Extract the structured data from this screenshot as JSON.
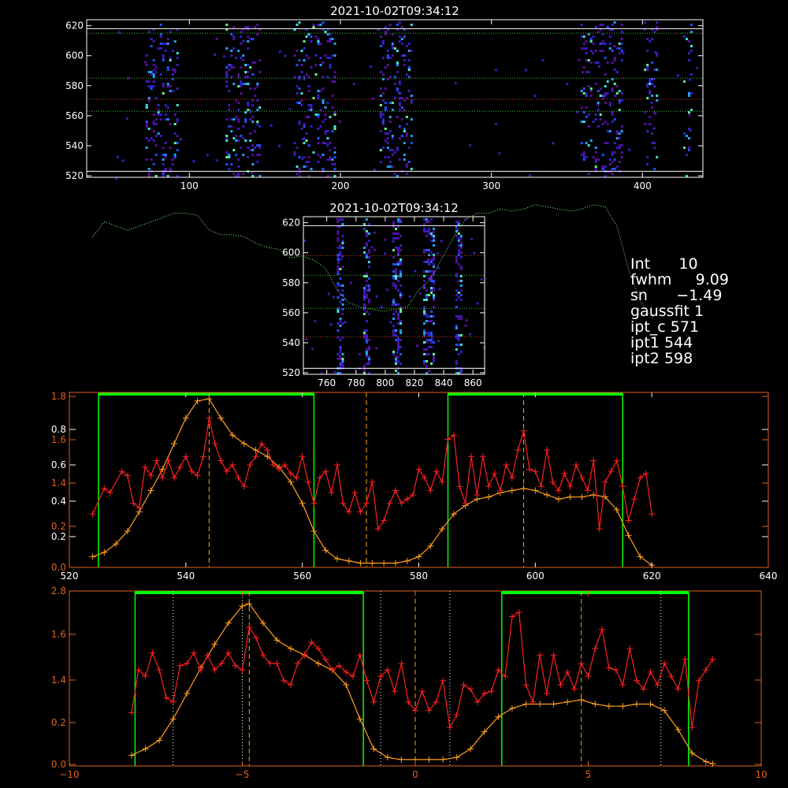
{
  "chart_data": [
    {
      "type": "heatmap",
      "title": "2021-10-02T09:34:12",
      "xlim": [
        32,
        440
      ],
      "ylim": [
        519,
        624
      ],
      "xticks": [
        100,
        200,
        300,
        400
      ],
      "yticks": [
        520,
        540,
        560,
        580,
        600,
        620
      ],
      "vertical_bands": [
        [
          72,
          91
        ],
        [
          125,
          146
        ],
        [
          170,
          196
        ],
        [
          227,
          246
        ],
        [
          360,
          385
        ],
        [
          402,
          408
        ],
        [
          428,
          431
        ]
      ],
      "hlines_white": [
        523,
        618
      ],
      "hlines_green_dotted": [
        563,
        585,
        615
      ],
      "hlines_red_dotted": [
        571
      ]
    },
    {
      "type": "heatmap",
      "title": "2021-10-02T09:34:12",
      "xlim": [
        744,
        868
      ],
      "ylim": [
        519,
        624
      ],
      "xticks": [
        760,
        780,
        800,
        820,
        840,
        860
      ],
      "yticks": [
        520,
        540,
        560,
        580,
        600,
        620
      ],
      "vertical_bands": [
        [
          768,
          770
        ],
        [
          786,
          788
        ],
        [
          806,
          810
        ],
        [
          827,
          832
        ],
        [
          849,
          851
        ]
      ],
      "hlines_white": [
        523,
        618
      ],
      "hlines_green_dotted": [
        563,
        585
      ],
      "hlines_red_dotted": [
        544,
        598
      ]
    },
    {
      "type": "line",
      "xlim": [
        520,
        640
      ],
      "xticks": [
        520,
        540,
        560,
        580,
        600,
        620,
        640
      ],
      "yticks_white": [
        "0.2",
        "0.4",
        "0.6",
        "0.8"
      ],
      "yticks_orange": [
        "0.0",
        "0.2",
        "1.4",
        "1.6",
        "1.8"
      ],
      "windows": [
        [
          525,
          562
        ],
        [
          585,
          615
        ]
      ],
      "vlines_orange_dashed": [
        544,
        571,
        598
      ],
      "series": [
        {
          "x": [
            524,
            526,
            528,
            530,
            532,
            534,
            536,
            538,
            540,
            542,
            544,
            546,
            548,
            550,
            552,
            554,
            556,
            558,
            560,
            562,
            564,
            566,
            568,
            570,
            572,
            574,
            576,
            578,
            580,
            582,
            584,
            586,
            588,
            590,
            592,
            594,
            596,
            598,
            600,
            602,
            604,
            606,
            608,
            610,
            612,
            614,
            616,
            618,
            620
          ],
          "values": [
            0.05,
            0.07,
            0.11,
            0.17,
            0.26,
            0.36,
            0.46,
            0.58,
            0.7,
            0.78,
            0.79,
            0.7,
            0.62,
            0.58,
            0.55,
            0.52,
            0.47,
            0.4,
            0.3,
            0.17,
            0.08,
            0.04,
            0.03,
            0.02,
            0.02,
            0.02,
            0.02,
            0.03,
            0.05,
            0.1,
            0.18,
            0.25,
            0.29,
            0.32,
            0.33,
            0.35,
            0.36,
            0.37,
            0.36,
            0.34,
            0.32,
            0.33,
            0.33,
            0.34,
            0.33,
            0.27,
            0.15,
            0.05,
            0.01
          ]
        },
        {
          "x": [
            524,
            526,
            528,
            530,
            532,
            534,
            536,
            538,
            540,
            542,
            544,
            546,
            548,
            550,
            552,
            554,
            556,
            558,
            560,
            562,
            564,
            566,
            568,
            570,
            572,
            574,
            576,
            578,
            580,
            582,
            584,
            586,
            588,
            590,
            592,
            594,
            596,
            598,
            600,
            602,
            604,
            606,
            608,
            610,
            612,
            614,
            616,
            618,
            620
          ],
          "values": [
            1.55,
            1.62,
            1.6,
            1.58,
            1.6,
            1.62,
            1.64,
            1.66,
            1.66,
            1.65,
            1.58,
            1.56,
            1.56,
            1.55,
            1.52,
            1.5,
            1.49,
            1.45,
            1.46,
            1.44,
            1.4,
            1.3,
            1.24,
            1.22,
            1.21,
            1.2,
            1.21,
            1.22,
            1.3,
            1.35,
            1.45,
            1.55,
            1.63,
            1.66,
            1.66,
            1.68,
            1.67,
            1.68,
            1.7,
            1.69,
            1.68,
            1.67,
            1.68,
            1.7,
            1.69,
            1.6,
            1.4,
            1.25,
            1.17
          ]
        },
        {
          "x": [
            524,
            526,
            527,
            529,
            530,
            531,
            532,
            533,
            534,
            535,
            536,
            537,
            538,
            539,
            540,
            541,
            542,
            543,
            544,
            545,
            546,
            547,
            548,
            549,
            550,
            551,
            552,
            553,
            554,
            555,
            556,
            557,
            558,
            559,
            560,
            561,
            562,
            563,
            564,
            565,
            566,
            567,
            568,
            569,
            570,
            571,
            572,
            573,
            574,
            575,
            576,
            577,
            578,
            579,
            580,
            581,
            582,
            583,
            584,
            585,
            586,
            587,
            588,
            589,
            590,
            591,
            592,
            593,
            594,
            595,
            596,
            597,
            598,
            599,
            600,
            601,
            602,
            603,
            604,
            605,
            606,
            607,
            608,
            609,
            610,
            611,
            612,
            613,
            614,
            615,
            616,
            617,
            618,
            619,
            620
          ],
          "values": [
            0.25,
            0.37,
            0.35,
            0.45,
            0.43,
            0.3,
            0.28,
            0.47,
            0.43,
            0.5,
            0.42,
            0.5,
            0.42,
            0.47,
            0.52,
            0.45,
            0.43,
            0.52,
            0.7,
            0.58,
            0.5,
            0.45,
            0.48,
            0.42,
            0.38,
            0.48,
            0.52,
            0.58,
            0.55,
            0.48,
            0.46,
            0.48,
            0.44,
            0.42,
            0.52,
            0.4,
            0.3,
            0.42,
            0.45,
            0.35,
            0.48,
            0.3,
            0.26,
            0.35,
            0.26,
            0.3,
            0.4,
            0.18,
            0.22,
            0.3,
            0.36,
            0.3,
            0.32,
            0.34,
            0.46,
            0.42,
            0.36,
            0.45,
            0.4,
            0.6,
            0.62,
            0.38,
            0.3,
            0.52,
            0.34,
            0.52,
            0.38,
            0.44,
            0.36,
            0.48,
            0.42,
            0.55,
            0.64,
            0.46,
            0.45,
            0.38,
            0.55,
            0.4,
            0.36,
            0.44,
            0.38,
            0.48,
            0.42,
            0.36,
            0.5,
            0.18,
            0.4,
            0.45,
            0.5,
            0.38,
            0.22,
            0.32,
            0.42,
            0.44,
            0.25
          ]
        }
      ]
    },
    {
      "type": "line",
      "xlim": [
        -10,
        10
      ],
      "xticks": [
        -10,
        -5,
        0,
        5,
        10
      ],
      "yticks": [
        "0.0",
        "0.2",
        "1.4",
        "1.6",
        "2.8"
      ],
      "windows": [
        [
          -8.1,
          -1.5
        ],
        [
          2.5,
          7.9
        ]
      ],
      "vlines_white_dotted": [
        -7.0,
        -5.0,
        -1.0,
        1.0,
        7.1
      ],
      "vlines_orange_dashed": [
        -4.8,
        0.0,
        4.8
      ],
      "series": [
        {
          "x": [
            -8.2,
            -7.8,
            -7.4,
            -7.0,
            -6.6,
            -6.2,
            -5.8,
            -5.4,
            -5.0,
            -4.8,
            -4.4,
            -4.0,
            -3.6,
            -3.2,
            -2.8,
            -2.4,
            -2.0,
            -1.6,
            -1.2,
            -0.8,
            -0.4,
            0.0,
            0.4,
            0.8,
            1.2,
            1.6,
            2.0,
            2.4,
            2.8,
            3.2,
            3.6,
            4.0,
            4.4,
            4.8,
            5.2,
            5.6,
            6.0,
            6.4,
            6.8,
            7.2,
            7.6,
            8.0,
            8.4,
            8.6
          ],
          "values": [
            0.05,
            0.08,
            0.12,
            0.22,
            0.34,
            0.46,
            0.57,
            0.67,
            0.75,
            0.76,
            0.67,
            0.59,
            0.55,
            0.52,
            0.48,
            0.45,
            0.38,
            0.22,
            0.08,
            0.04,
            0.03,
            0.03,
            0.03,
            0.03,
            0.04,
            0.08,
            0.16,
            0.23,
            0.27,
            0.29,
            0.29,
            0.29,
            0.3,
            0.31,
            0.29,
            0.28,
            0.28,
            0.29,
            0.29,
            0.26,
            0.17,
            0.06,
            0.02,
            0.01
          ]
        },
        {
          "x": [
            -8.2,
            -8.0,
            -7.8,
            -7.6,
            -7.4,
            -7.2,
            -7.0,
            -6.8,
            -6.6,
            -6.4,
            -6.2,
            -6.0,
            -5.8,
            -5.6,
            -5.4,
            -5.2,
            -5.0,
            -4.8,
            -4.6,
            -4.4,
            -4.2,
            -4.0,
            -3.8,
            -3.6,
            -3.4,
            -3.2,
            -3.0,
            -2.8,
            -2.6,
            -2.4,
            -2.2,
            -2.0,
            -1.8,
            -1.6,
            -1.4,
            -1.2,
            -1.0,
            -0.8,
            -0.6,
            -0.4,
            -0.2,
            0.0,
            0.2,
            0.4,
            0.6,
            0.8,
            1.0,
            1.2,
            1.4,
            1.6,
            1.8,
            2.0,
            2.2,
            2.4,
            2.6,
            2.8,
            3.0,
            3.2,
            3.4,
            3.6,
            3.8,
            4.0,
            4.2,
            4.4,
            4.6,
            4.8,
            5.0,
            5.2,
            5.4,
            5.6,
            5.8,
            6.0,
            6.2,
            6.4,
            6.6,
            6.8,
            7.0,
            7.2,
            7.4,
            7.6,
            7.8,
            8.0,
            8.2,
            8.4,
            8.6
          ],
          "values": [
            0.25,
            0.45,
            0.42,
            0.53,
            0.45,
            0.32,
            0.3,
            0.47,
            0.48,
            0.53,
            0.45,
            0.52,
            0.45,
            0.48,
            0.53,
            0.47,
            0.45,
            0.65,
            0.6,
            0.52,
            0.48,
            0.48,
            0.4,
            0.38,
            0.48,
            0.52,
            0.58,
            0.55,
            0.5,
            0.45,
            0.47,
            0.44,
            0.42,
            0.52,
            0.4,
            0.3,
            0.42,
            0.45,
            0.35,
            0.48,
            0.3,
            0.26,
            0.35,
            0.26,
            0.3,
            0.4,
            0.18,
            0.24,
            0.38,
            0.36,
            0.3,
            0.34,
            0.35,
            0.45,
            0.42,
            0.7,
            0.72,
            0.38,
            0.3,
            0.52,
            0.34,
            0.52,
            0.38,
            0.44,
            0.36,
            0.48,
            0.42,
            0.55,
            0.64,
            0.46,
            0.45,
            0.38,
            0.55,
            0.4,
            0.36,
            0.44,
            0.38,
            0.48,
            0.42,
            0.36,
            0.5,
            0.18,
            0.4,
            0.45,
            0.5
          ]
        }
      ]
    }
  ],
  "info": {
    "int_label": "Int",
    "int_value": "10",
    "fwhm_label": "fwhm",
    "fwhm_value": "9.09",
    "sn_label": "sn",
    "sn_value": "−1.49",
    "gaussfit_label": "gaussfit",
    "gaussfit_value": "1",
    "ipt_c_label": "ipt_c",
    "ipt_c_value": "571",
    "ipt1_label": "ipt1",
    "ipt1_value": "544",
    "ipt2_label": "ipt2",
    "ipt2_value": "598"
  },
  "colors": {
    "background": "#000000",
    "axes": "#ffffff",
    "axes_orange": "#e06020",
    "profile_orange": "#ffa020",
    "profile_red": "#ff2020",
    "window_green": "#00ff00",
    "dotted_green": "#80ff80"
  }
}
